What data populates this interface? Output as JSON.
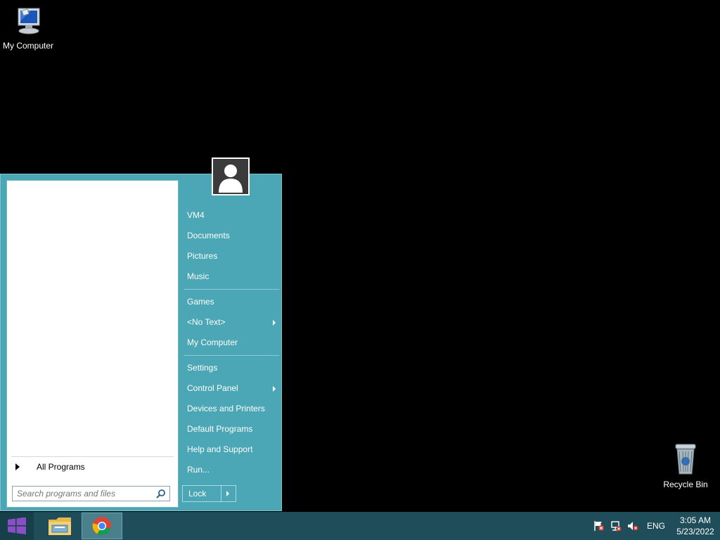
{
  "desktop": {
    "icons": [
      {
        "label": "My Computer"
      },
      {
        "label": "Recycle Bin"
      }
    ]
  },
  "start_menu": {
    "all_programs_label": "All Programs",
    "search_placeholder": "Search programs and files",
    "right_items": [
      {
        "label": "VM4"
      },
      {
        "label": "Documents"
      },
      {
        "label": "Pictures"
      },
      {
        "label": "Music"
      },
      {
        "label": "Games"
      },
      {
        "label": "<No Text>"
      },
      {
        "label": "My Computer"
      },
      {
        "label": "Settings"
      },
      {
        "label": "Control Panel"
      },
      {
        "label": "Devices and Printers"
      },
      {
        "label": "Default Programs"
      },
      {
        "label": "Help and Support"
      },
      {
        "label": "Run..."
      }
    ],
    "lock_label": "Lock"
  },
  "taskbar": {
    "language": "ENG",
    "time": "3:05 AM",
    "date": "5/23/2022",
    "accent_color": "#8a4fc7"
  }
}
